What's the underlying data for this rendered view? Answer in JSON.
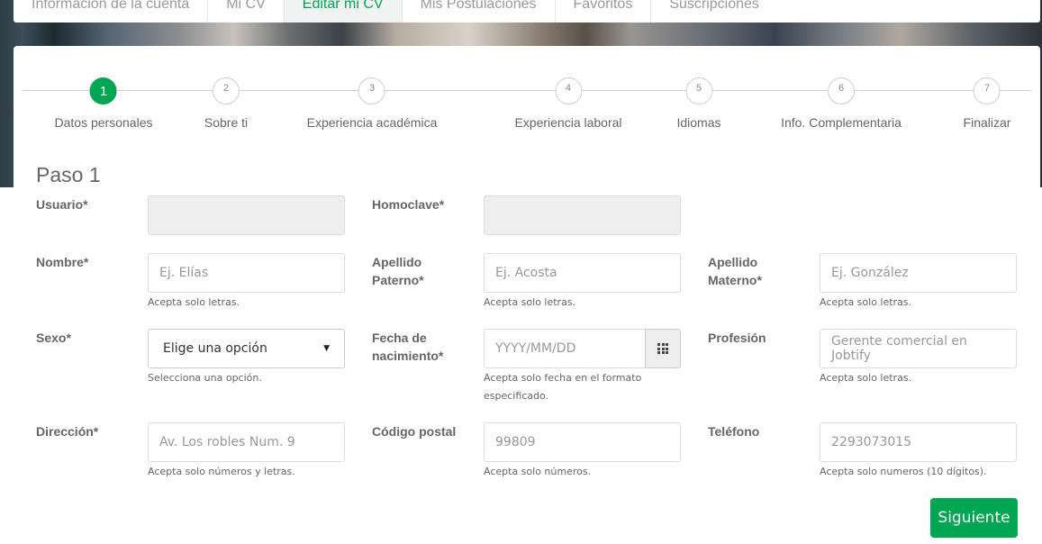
{
  "nav": {
    "tabs": [
      {
        "label": "Información de la cuenta"
      },
      {
        "label": "Mi CV"
      },
      {
        "label": "Editar mi CV"
      },
      {
        "label": "Mis Postulaciones"
      },
      {
        "label": "Favoritos"
      },
      {
        "label": "Suscripciones"
      }
    ],
    "active_tab": "Editar mi CV"
  },
  "stepper": {
    "steps": [
      {
        "number": "1",
        "label": "Datos personales",
        "active": true
      },
      {
        "number": "2",
        "label": "Sobre ti"
      },
      {
        "number": "3",
        "label": "Experiencia académica"
      },
      {
        "number": "4",
        "label": "Experiencia laboral"
      },
      {
        "number": "5",
        "label": "Idiomas"
      },
      {
        "number": "6",
        "label": "Info. Complementaria"
      },
      {
        "number": "7",
        "label": "Finalizar"
      }
    ]
  },
  "form": {
    "title": "Paso 1",
    "usuario": {
      "label": "Usuario*",
      "value": ""
    },
    "homoclave": {
      "label": "Homoclave*",
      "value": ""
    },
    "nombre": {
      "label": "Nombre*",
      "placeholder": "Ej. Elías",
      "help": "Acepta solo letras."
    },
    "apellido_paterno": {
      "label_line1": "Apellido",
      "label_line2": "Paterno*",
      "placeholder": "Ej. Acosta",
      "help": "Acepta solo letras."
    },
    "apellido_materno": {
      "label_line1": "Apellido",
      "label_line2": "Materno*",
      "placeholder": "Ej. González",
      "help": "Acepta solo letras."
    },
    "sexo": {
      "label": "Sexo*",
      "selected": "Elige una opción",
      "help": "Selecciona una opción."
    },
    "fecha_nacimiento": {
      "label_line1": "Fecha de",
      "label_line2": "nacimiento*",
      "placeholder": "YYYY/MM/DD",
      "help_line1": "Acepta solo fecha en el formato",
      "help_line2": "especificado."
    },
    "profesion": {
      "label": "Profesión",
      "placeholder": "Gerente comercial en Jobtify",
      "help": "Acepta solo letras."
    },
    "direccion": {
      "label": "Dirección*",
      "placeholder": "Av. Los robles Num. 9",
      "help": "Acepta solo números y letras."
    },
    "codigo_postal": {
      "label": "Código postal",
      "placeholder": "99809",
      "help": "Acepta solo números."
    },
    "telefono": {
      "label": "Teléfono",
      "placeholder": "2293073015",
      "help": "Acepta solo numeros (10 dígitos)."
    },
    "next_label": "Siguiente"
  },
  "colors": {
    "accent": "#00a651",
    "disabled_input": "#eeeeee",
    "text": "#666666"
  }
}
